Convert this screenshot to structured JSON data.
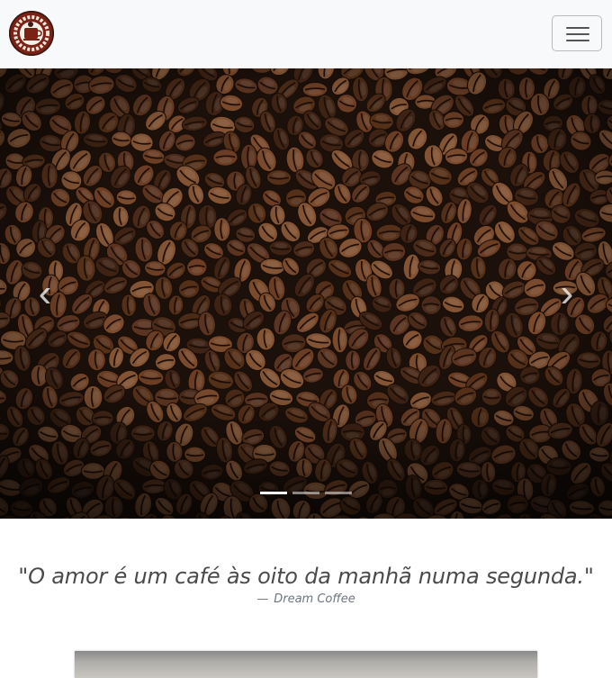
{
  "navbar": {
    "logo_icon": "coffee-shop-logo",
    "toggler_icon": "hamburger-menu-icon"
  },
  "carousel": {
    "image": "coffee-beans-photo",
    "prev_icon": "chevron-left-icon",
    "next_icon": "chevron-right-icon",
    "prev_glyph": "‹",
    "next_glyph": "›",
    "slide_count": 3,
    "active_index": 0
  },
  "quote": {
    "text": "\"O amor é um café às oito da manhã numa segunda.\"",
    "dash": "—",
    "author": "Dream Coffee"
  },
  "colors": {
    "navbar_bg": "#f8f9fa",
    "bean_dark": "#2a1810",
    "logo_red": "#7a2216"
  }
}
